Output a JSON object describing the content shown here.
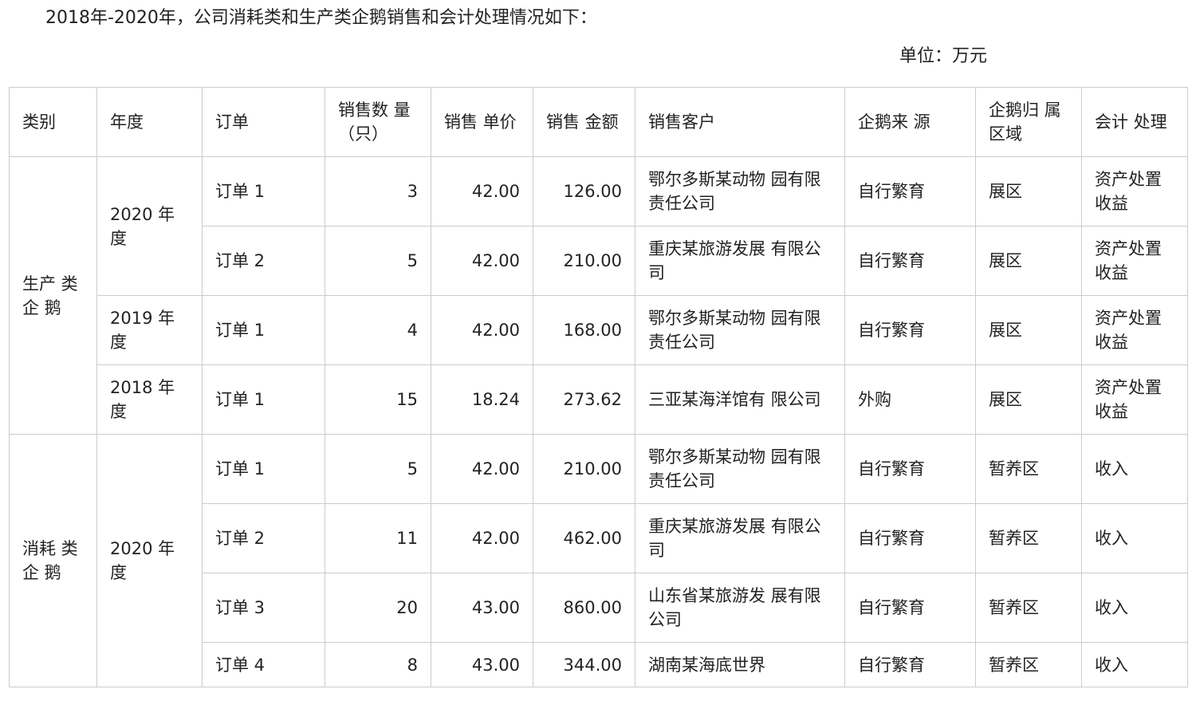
{
  "intro": "2018年-2020年，公司消耗类和生产类企鹅销售和会计处理情况如下：",
  "unit": "单位：万元",
  "table": {
    "headers": [
      "类别",
      "年度",
      "订单",
      "销售数 量（只）",
      "销售 单价",
      "销售 金额",
      "销售客户",
      "企鹅来 源",
      "企鹅归 属区域",
      "会计 处理"
    ],
    "groups": [
      {
        "category": "生产 类企 鹅",
        "years": [
          {
            "year": "2020 年度",
            "orders": [
              {
                "order": "订单 1",
                "qty": "3",
                "price": "42.00",
                "amount": "126.00",
                "customer": "鄂尔多斯某动物 园有限责任公司",
                "source": "自行繁育",
                "region": "展区",
                "accounting": "资产处置收益"
              },
              {
                "order": "订单 2",
                "qty": "5",
                "price": "42.00",
                "amount": "210.00",
                "customer": "重庆某旅游发展 有限公司",
                "source": "自行繁育",
                "region": "展区",
                "accounting": "资产处置收益"
              }
            ]
          },
          {
            "year": "2019 年度",
            "orders": [
              {
                "order": "订单 1",
                "qty": "4",
                "price": "42.00",
                "amount": "168.00",
                "customer": "鄂尔多斯某动物 园有限责任公司",
                "source": "自行繁育",
                "region": "展区",
                "accounting": "资产处置收益"
              }
            ]
          },
          {
            "year": "2018 年度",
            "orders": [
              {
                "order": "订单 1",
                "qty": "15",
                "price": "18.24",
                "amount": "273.62",
                "customer": "三亚某海洋馆有 限公司",
                "source": "外购",
                "region": "展区",
                "accounting": "资产处置收益"
              }
            ]
          }
        ]
      },
      {
        "category": "消耗 类企 鹅",
        "years": [
          {
            "year": "2020 年度",
            "orders": [
              {
                "order": "订单 1",
                "qty": "5",
                "price": "42.00",
                "amount": "210.00",
                "customer": "鄂尔多斯某动物 园有限责任公司",
                "source": "自行繁育",
                "region": "暂养区",
                "accounting": "收入"
              },
              {
                "order": "订单 2",
                "qty": "11",
                "price": "42.00",
                "amount": "462.00",
                "customer": "重庆某旅游发展 有限公司",
                "source": "自行繁育",
                "region": "暂养区",
                "accounting": "收入"
              },
              {
                "order": "订单 3",
                "qty": "20",
                "price": "43.00",
                "amount": "860.00",
                "customer": "山东省某旅游发 展有限公司",
                "source": "自行繁育",
                "region": "暂养区",
                "accounting": "收入"
              },
              {
                "order": "订单 4",
                "qty": "8",
                "price": "43.00",
                "amount": "344.00",
                "customer": "湖南某海底世界",
                "source": "自行繁育",
                "region": "暂养区",
                "accounting": "收入"
              }
            ]
          }
        ]
      }
    ]
  }
}
